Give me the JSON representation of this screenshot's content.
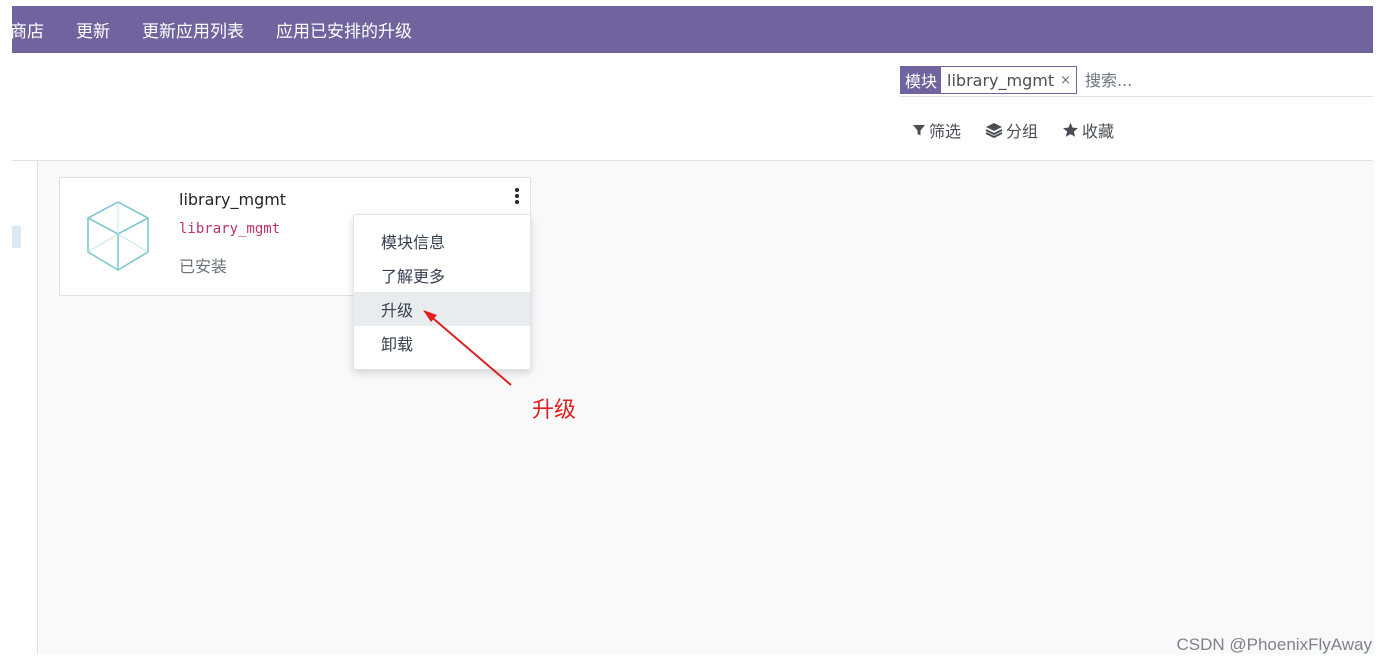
{
  "nav": {
    "items": [
      "商店",
      "更新",
      "更新应用列表",
      "应用已安排的升级"
    ]
  },
  "search": {
    "facet_label": "模块",
    "facet_value": "library_mgmt",
    "facet_remove": "×",
    "placeholder": "搜索..."
  },
  "filters": {
    "filter_label": "筛选",
    "group_label": "分组",
    "favorites_label": "收藏"
  },
  "card": {
    "title": "library_mgmt",
    "technical_name": "library_mgmt",
    "status": "已安装",
    "icon": "cube-icon"
  },
  "dropdown": {
    "items": [
      "模块信息",
      "了解更多",
      "升级",
      "卸载"
    ],
    "active_item": "升级"
  },
  "annotation": {
    "text": "升级",
    "color": "#e0201f"
  },
  "watermark": "CSDN @PhoenixFlyAway",
  "colors": {
    "brand": "#71639e",
    "tech_name": "#c0326c"
  }
}
